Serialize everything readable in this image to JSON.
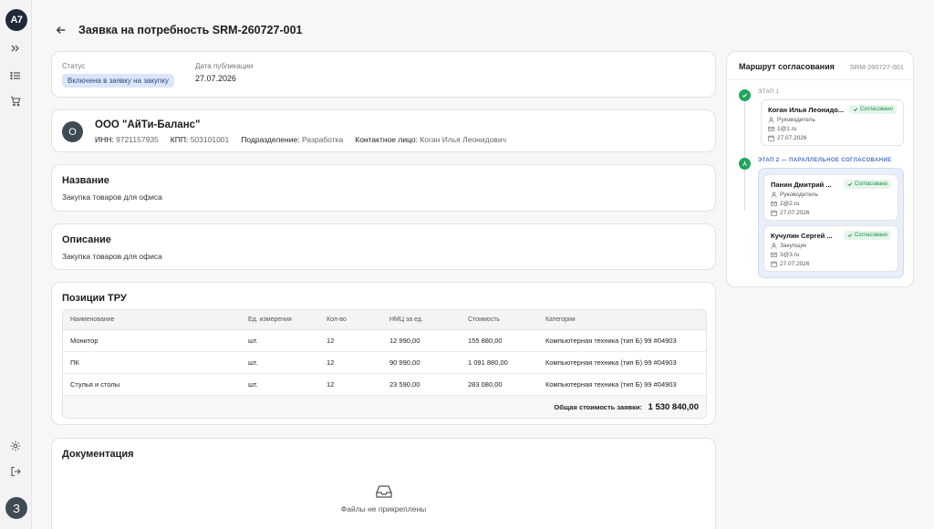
{
  "logo": {
    "text": "A7"
  },
  "sidebar": {
    "user_initial": "З",
    "icons": [
      "chevrons-right-icon",
      "list-icon",
      "cart-icon",
      "gear-icon",
      "logout-icon"
    ]
  },
  "header": {
    "title": "Заявка на потребность SRM-260727-001"
  },
  "status": {
    "label": "Статус",
    "badge": "Включена в заявку на закупку",
    "date_label": "Дата публикации",
    "date_value": "27.07.2026"
  },
  "company": {
    "initial": "О",
    "name": "ООО \"АйТи-Баланс\"",
    "inn_label": "ИНН:",
    "inn": "9721157935",
    "kpp_label": "КПП:",
    "kpp": "503101001",
    "dept_label": "Подразделение:",
    "dept": "Разработка",
    "contact_label": "Контактное лицо:",
    "contact": "Коган Илья Леонидович"
  },
  "name_section": {
    "title": "Название",
    "text": "Закупка товаров для офиса"
  },
  "desc_section": {
    "title": "Описание",
    "text": "Закупка товаров для офиса"
  },
  "items": {
    "title": "Позиции ТРУ",
    "columns": [
      "Наименование",
      "Ед. измерения",
      "Кол-во",
      "НМЦ за ед.",
      "Стоимость",
      "Категория"
    ],
    "rows": [
      [
        "Монитор",
        "шт.",
        "12",
        "12 990,00",
        "155 880,00",
        "Компьютерная техника (тип Б) 99 #04903"
      ],
      [
        "ПК",
        "шт.",
        "12",
        "90 990,00",
        "1 091 880,00",
        "Компьютерная техника (тип Б) 99 #04903"
      ],
      [
        "Стулья и столы",
        "шт.",
        "12",
        "23 590,00",
        "283 080,00",
        "Компьютерная техника (тип Б) 99 #04903"
      ]
    ],
    "total_label": "Общая стоимость заявки:",
    "total_value": "1 530 840,00"
  },
  "docs": {
    "title": "Документация",
    "empty_text": "Файлы не прикреплены"
  },
  "route": {
    "title": "Маршрут согласования",
    "id": "SRM-260727-001",
    "stage1_label": "ЭТАП 1",
    "stage2_label": "ЭТАП 2 — ПАРАЛЛЕЛЬНОЕ СОГЛАСОВАНИЕ",
    "approvers": [
      {
        "name": "Коган Илья Леонидо...",
        "badge": "Согласовано",
        "role": "Руководитель",
        "email": "1@1.ru",
        "date": "27.07.2026"
      },
      {
        "name": "Панин Дмитрий ...",
        "badge": "Согласовано",
        "role": "Руководитель",
        "email": "2@2.ru",
        "date": "27.07.2026"
      },
      {
        "name": "Кучулин Сергей ...",
        "badge": "Согласовано",
        "role": "Закупщик",
        "email": "3@3.ru",
        "date": "27.07.2026"
      }
    ]
  },
  "colors": {
    "accent": "#22a55b",
    "badge_bg": "#dbe6fb",
    "stage2": "#4a73c4"
  }
}
